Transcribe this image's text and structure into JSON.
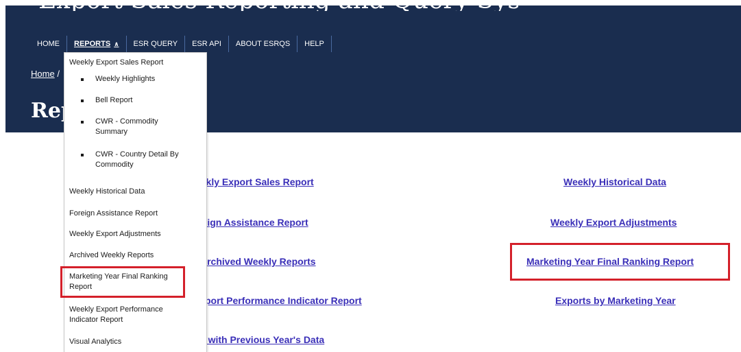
{
  "header": {
    "site_title": "Export Sales Reporting and Query System"
  },
  "nav": {
    "items": [
      {
        "label": "HOME"
      },
      {
        "label": "REPORTS"
      },
      {
        "label": "ESR QUERY"
      },
      {
        "label": "ESR API"
      },
      {
        "label": "ABOUT ESRQS"
      },
      {
        "label": "HELP"
      }
    ],
    "caret": "^"
  },
  "breadcrumb": {
    "home": "Home",
    "separator": "/"
  },
  "page": {
    "title": "Reports"
  },
  "dropdown": {
    "weekly_export_sales_report": "Weekly Export Sales Report",
    "sub_items": [
      {
        "label": "Weekly Highlights"
      },
      {
        "label": "Bell Report"
      },
      {
        "label": "CWR - Commodity Summary"
      },
      {
        "label": "CWR - Country Detail By Commodity"
      }
    ],
    "items": [
      {
        "label": "Weekly Historical Data"
      },
      {
        "label": "Foreign Assistance Report"
      },
      {
        "label": "Weekly Export Adjustments"
      },
      {
        "label": "Archived Weekly Reports"
      },
      {
        "label": "Marketing Year Final Ranking Report"
      },
      {
        "label": "Weekly Export Performance Indicator Report"
      },
      {
        "label": "Visual Analytics"
      }
    ]
  },
  "links": {
    "left": [
      {
        "label": "Weekly Export Sales Report"
      },
      {
        "label": "Foreign Assistance Report"
      },
      {
        "label": "Archived Weekly Reports"
      },
      {
        "label": "Weekly Export Performance Indicator Report"
      },
      {
        "label": "Comparison with Previous Year's Data"
      }
    ],
    "right": [
      {
        "label": "Weekly Historical Data"
      },
      {
        "label": "Weekly Export Adjustments"
      },
      {
        "label": "Marketing Year Final Ranking Report"
      },
      {
        "label": "Exports by Marketing Year"
      }
    ]
  },
  "colors": {
    "header_bg": "#1a2d4f",
    "link": "#3a2fb8",
    "highlight": "#d4202a"
  }
}
